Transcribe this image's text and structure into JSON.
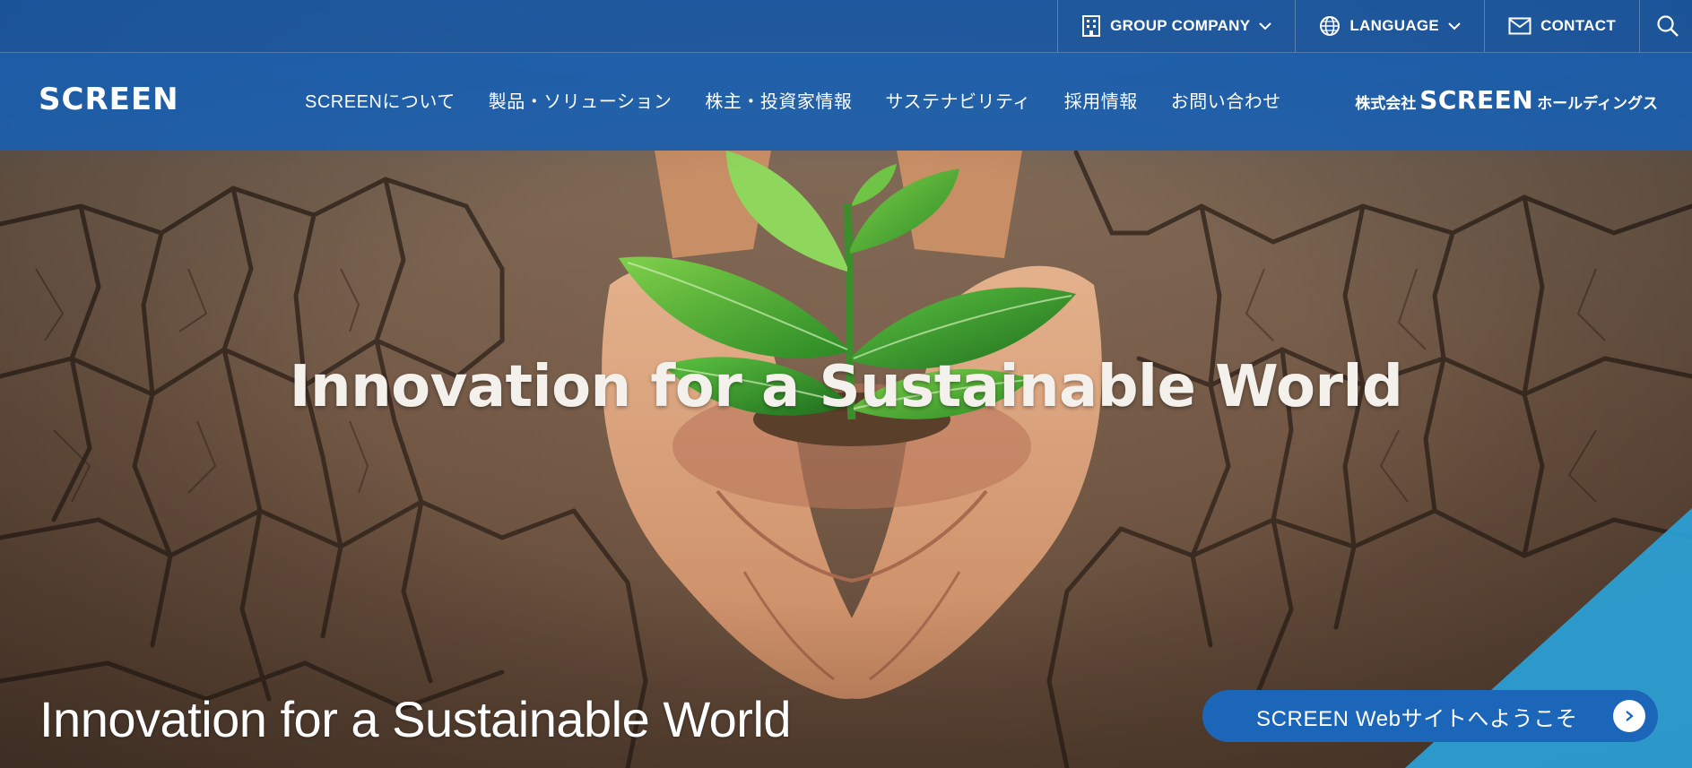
{
  "utility_bar": {
    "group_company": "GROUP COMPANY",
    "language": "LANGUAGE",
    "contact": "CONTACT"
  },
  "header": {
    "logo": "SCREEN",
    "nav": [
      {
        "label": "SCREENについて"
      },
      {
        "label": "製品・ソリューション"
      },
      {
        "label": "株主・投資家情報"
      },
      {
        "label": "サステナビリティ"
      },
      {
        "label": "採用情報"
      },
      {
        "label": "お問い合わせ"
      }
    ],
    "holdings_prefix": "株式会社",
    "holdings_brand": "SCREEN",
    "holdings_suffix": "ホールディングス"
  },
  "hero": {
    "headline": "Innovation for a Sustainable World",
    "caption": "Innovation for a Sustainable World",
    "welcome_button": "SCREEN Webサイトへようこそ"
  },
  "colors": {
    "nav_blue": "#1660b4",
    "accent_cyan": "#2aa2d8",
    "welcome_blue": "#1b66b8"
  },
  "icons": [
    "building-icon",
    "chevron-down-icon",
    "globe-icon",
    "mail-icon",
    "search-icon",
    "arrow-right-icon"
  ]
}
